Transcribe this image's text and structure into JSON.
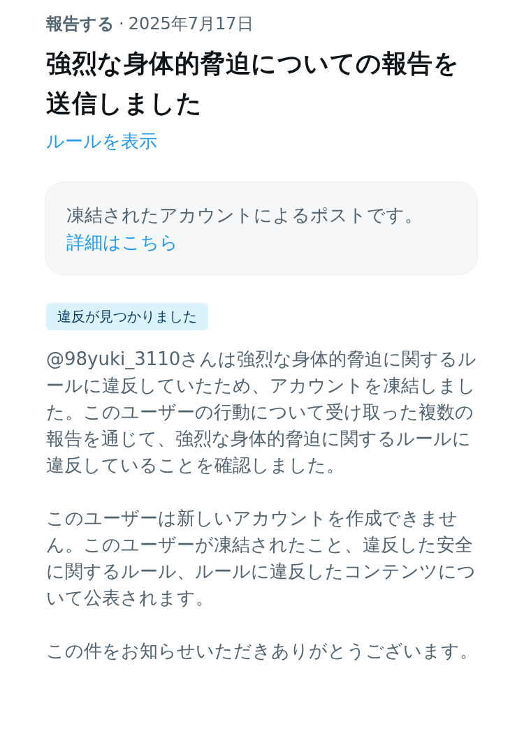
{
  "header": {
    "label": "報告する",
    "separator": "·",
    "date": "2025年7月17日"
  },
  "title": "強烈な身体的脅迫についての報告を送信しました",
  "rules_link": "ルールを表示",
  "notice": {
    "text": "凍結されたアカウントによるポストです。",
    "link": "詳細はこちら"
  },
  "status_badge": "違反が見つかりました",
  "paragraphs": [
    "@98yuki_3110さんは強烈な身体的脅迫に関するルールに違反していたため、アカウントを凍結しました。このユーザーの行動について受け取った複数の報告を通じて、強烈な身体的脅迫に関するルールに違反していることを確認しました。",
    "このユーザーは新しいアカウントを作成できません。このユーザーが凍結されたこと、違反した安全に関するルール、ルールに違反したコンテンツについて公表されます。",
    "この件をお知らせいただきありがとうございます。"
  ]
}
